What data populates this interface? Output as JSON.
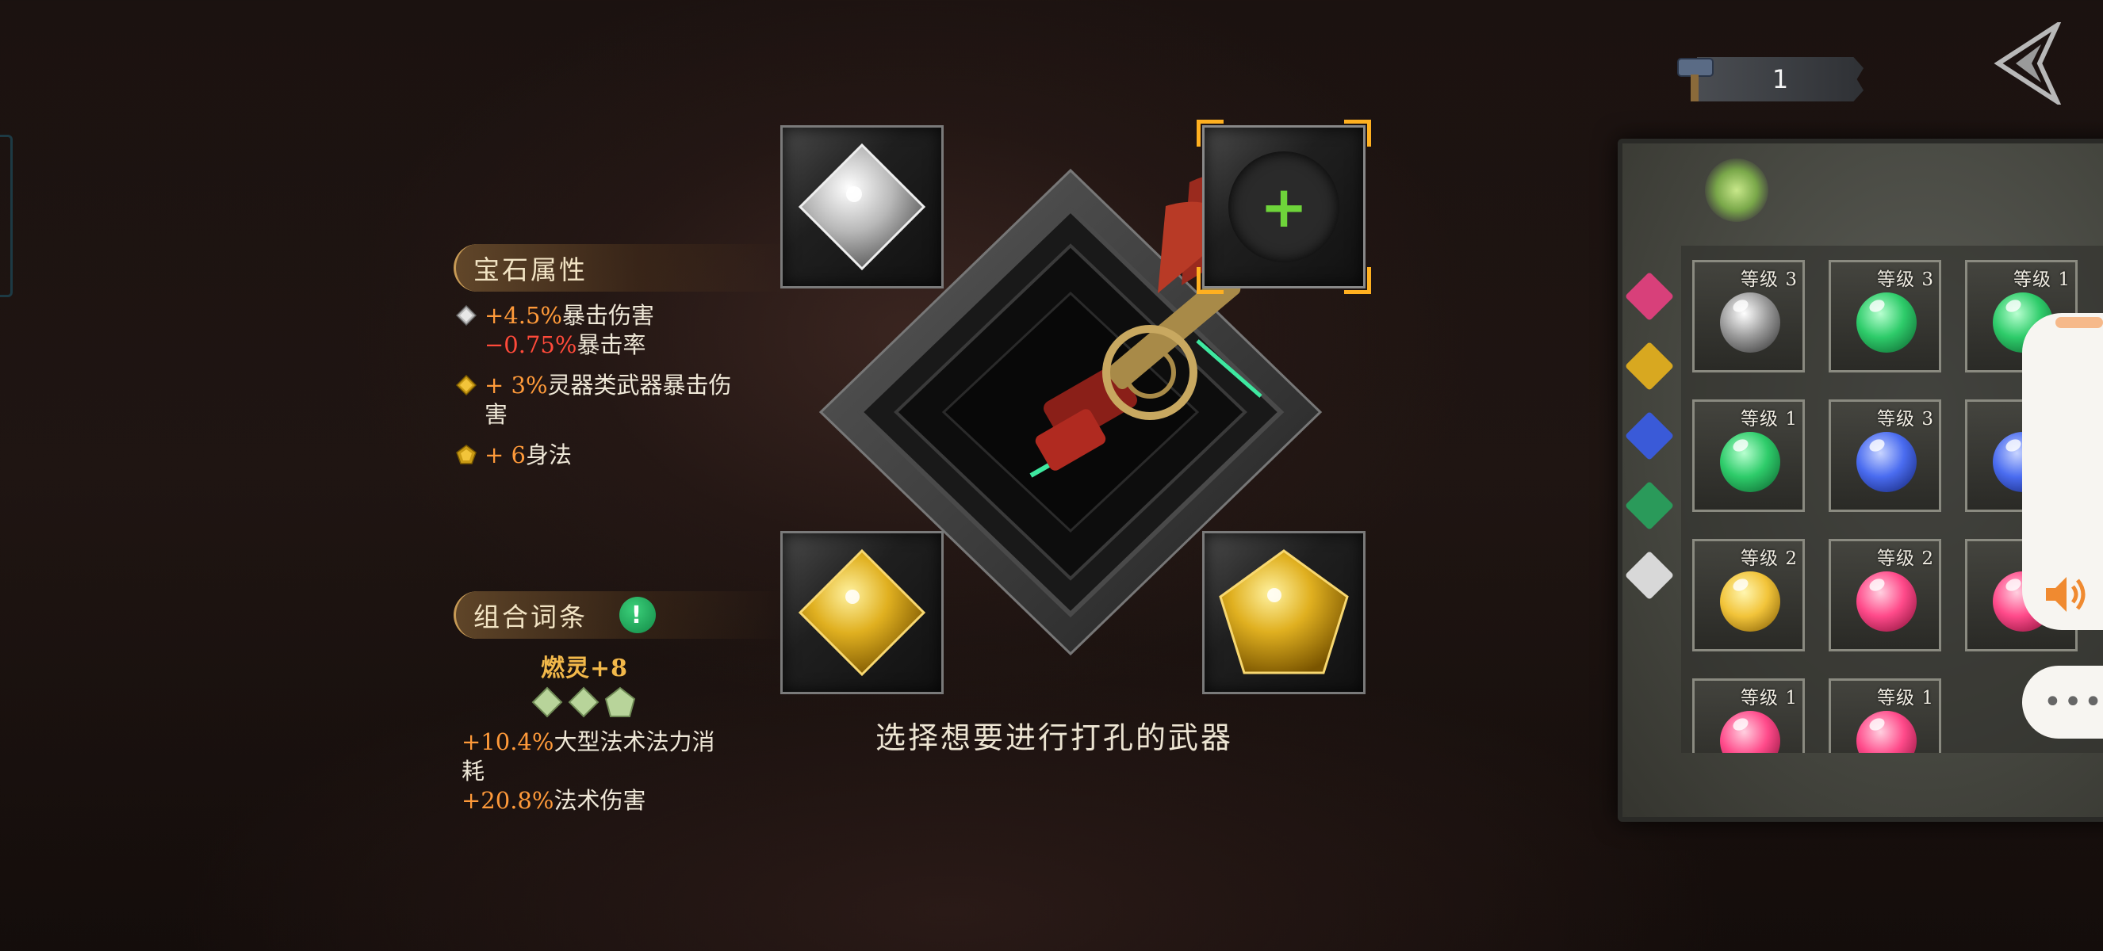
{
  "gem_attributes": {
    "header": "宝石属性",
    "lines": [
      {
        "icon": "silver-diamond-gem-icon",
        "parts": [
          {
            "value": "+4.5%",
            "label": "暴击伤害"
          },
          {
            "value": "−0.75%",
            "label": "暴击率"
          }
        ]
      },
      {
        "icon": "gold-diamond-gem-icon",
        "parts": [
          {
            "value": "+ 3%",
            "label": "灵器类武器暴击伤害"
          }
        ]
      },
      {
        "icon": "gold-pentagon-gem-icon",
        "parts": [
          {
            "value": "+ 6",
            "label": "身法"
          }
        ]
      }
    ],
    "line2_label_a": "灵器类武器暴击伤",
    "line2_label_b": "害"
  },
  "combo": {
    "header": "组合词条",
    "info_icon": "!",
    "set_name": "燃灵+8",
    "bonus1_value": "+10.4%",
    "bonus1_label_a": "大型法术法力消",
    "bonus1_label_b": "耗",
    "bonus2_value": "+20.8%",
    "bonus2_label": "法术伤害"
  },
  "center": {
    "hint": "选择想要进行打孔的武器",
    "add_slot_symbol": "+"
  },
  "top_right": {
    "counter_value": "1",
    "counter_icon": "hammer-icon",
    "back_icon": "back-arrow-icon"
  },
  "gem_grid": [
    {
      "label": "等级 3",
      "color": "#d8d8d8"
    },
    {
      "label": "等级 3",
      "color": "#2ecc6a"
    },
    {
      "label": "等级 1",
      "color": "#2ecc6a"
    },
    {
      "label": "等级 1",
      "color": "#2ecc6a"
    },
    {
      "label": "等级 3",
      "color": "#4a6cf0"
    },
    {
      "label": "",
      "color": "#4a6cf0"
    },
    {
      "label": "等级 2",
      "color": "#f2c43a"
    },
    {
      "label": "等级 2",
      "color": "#ff4a8a"
    },
    {
      "label": "等",
      "color": "#ff4a8a"
    },
    {
      "label": "等级 1",
      "color": "#ff4a8a"
    },
    {
      "label": "等级 1",
      "color": "#ff4a8a"
    }
  ],
  "filter_tabs": [
    "pink",
    "gold",
    "blue",
    "green",
    "white"
  ],
  "colors": {
    "accent_orange": "#ff9a3a",
    "negative_red": "#ff4a3a",
    "add_green": "#6ed43a",
    "slot_highlight": "#ffb020"
  },
  "float_widget": {
    "sound_icon": "speaker-icon",
    "more_label": "•••"
  }
}
